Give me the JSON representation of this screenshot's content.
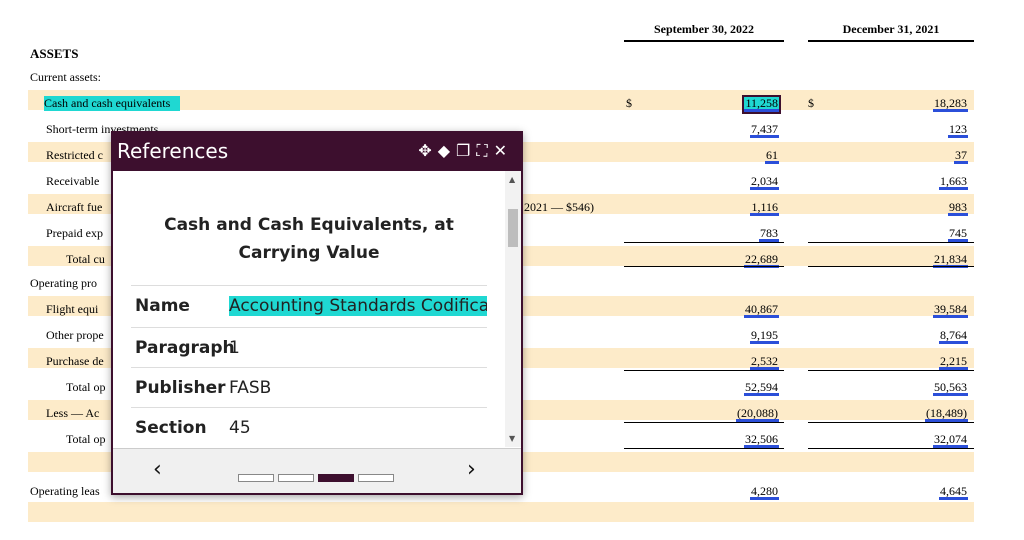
{
  "header": {
    "col1": "September 30, 2022",
    "col2": "December 31, 2021"
  },
  "section": {
    "assets": "ASSETS",
    "current_assets": "Current assets:",
    "operating_property": "Operating pro"
  },
  "rows": [
    {
      "label": "Cash and cash equivalents",
      "d1": "$",
      "v1": "11,258",
      "d2": "$",
      "v2": "18,283"
    },
    {
      "label": "Short-term investments",
      "v1": "7,437",
      "v2": "123"
    },
    {
      "label": "Restricted c",
      "v1": "61",
      "v2": "37"
    },
    {
      "label": "Receivable",
      "v1": "2,034",
      "v2": "1,663"
    },
    {
      "label": "Aircraft fue",
      "note": "2021 — $546)",
      "v1": "1,116",
      "v2": "983"
    },
    {
      "label": "Prepaid exp",
      "v1": "783",
      "v2": "745"
    },
    {
      "label": "Total cu",
      "v1": "22,689",
      "v2": "21,834"
    },
    {
      "label": "Flight equi",
      "v1": "40,867",
      "v2": "39,584"
    },
    {
      "label": "Other prope",
      "v1": "9,195",
      "v2": "8,764"
    },
    {
      "label": "Purchase de",
      "v1": "2,532",
      "v2": "2,215"
    },
    {
      "label": "Total op",
      "v1": "52,594",
      "v2": "50,563"
    },
    {
      "label": "Less — Ac",
      "v1": "(20,088)",
      "v2": "(18,489)"
    },
    {
      "label": "Total op",
      "v1": "32,506",
      "v2": "32,074"
    },
    {
      "label": "Operating leas",
      "v1": "4,280",
      "v2": "4,645"
    }
  ],
  "popup": {
    "title": "References",
    "ref_title": "Cash and Cash Equivalents, at Carrying Value",
    "fields": [
      {
        "key": "Name",
        "value": "Accounting Standards Codification"
      },
      {
        "key": "Paragraph",
        "value": "1"
      },
      {
        "key": "Publisher",
        "value": "FASB"
      },
      {
        "key": "Section",
        "value": "45"
      }
    ],
    "icons": [
      "move-icon",
      "diamond-icon",
      "copy-icon",
      "expand-icon",
      "close-icon"
    ],
    "prev": "‹",
    "next": "›"
  }
}
